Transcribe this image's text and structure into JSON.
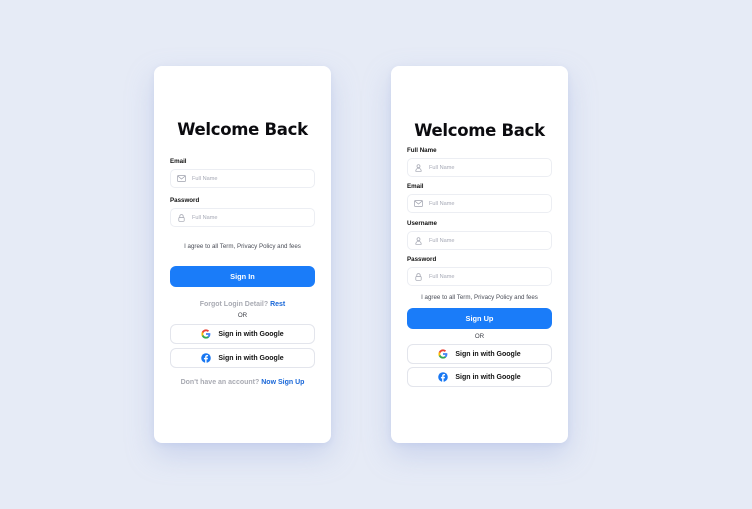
{
  "colors": {
    "background": "#e6ebf6",
    "card": "#ffffff",
    "primary": "#1a7cf9",
    "link": "#1967d8",
    "muted": "#a9abb3"
  },
  "login": {
    "title": "Welcome Back",
    "fields": [
      {
        "label": "Email",
        "placeholder": "Full Name",
        "icon": "mail-icon"
      },
      {
        "label": "Password",
        "placeholder": "Full Name",
        "icon": "lock-icon"
      }
    ],
    "agree_text": "I agree to all Term, Privacy Policy and fees",
    "submit_label": "Sign In",
    "forgot_text": "Forgot Login Detail?",
    "forgot_link": "Rest",
    "or_text": "OR",
    "social": [
      {
        "label": "Sign in with Google",
        "icon": "google-icon"
      },
      {
        "label": "Sign in with Google",
        "icon": "facebook-icon"
      }
    ],
    "footer_text": "Don't have an account?",
    "footer_link": "Now Sign Up"
  },
  "signup": {
    "title": "Welcome Back",
    "fields": [
      {
        "label": "Full Name",
        "placeholder": "Full Name",
        "icon": "user-icon"
      },
      {
        "label": "Email",
        "placeholder": "Full Name",
        "icon": "mail-icon"
      },
      {
        "label": "Username",
        "placeholder": "Full Name",
        "icon": "user-icon"
      },
      {
        "label": "Password",
        "placeholder": "Full Name",
        "icon": "lock-icon"
      }
    ],
    "agree_text": "I agree to all Term, Privacy Policy and fees",
    "submit_label": "Sign Up",
    "or_text": "OR",
    "social": [
      {
        "label": "Sign in with Google",
        "icon": "google-icon"
      },
      {
        "label": "Sign in with Google",
        "icon": "facebook-icon"
      }
    ]
  }
}
